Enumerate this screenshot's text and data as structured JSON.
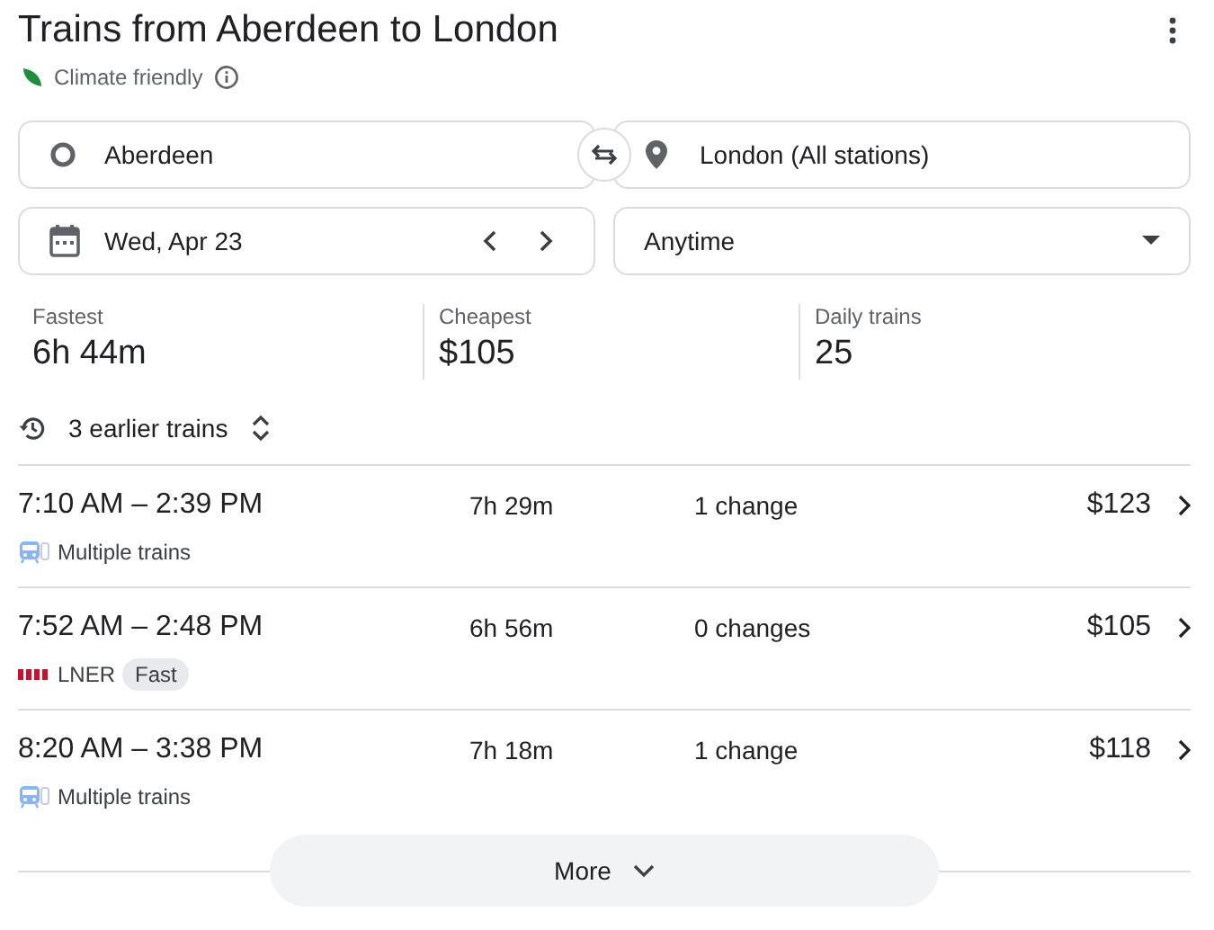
{
  "title": "Trains from Aberdeen to London",
  "climate_label": "Climate friendly",
  "origin": {
    "value": "Aberdeen"
  },
  "destination": {
    "value": "London (All stations)"
  },
  "date": {
    "value": "Wed, Apr 23"
  },
  "time": {
    "value": "Anytime"
  },
  "stats": [
    {
      "label": "Fastest",
      "value": "6h 44m"
    },
    {
      "label": "Cheapest",
      "value": "$105"
    },
    {
      "label": "Daily trains",
      "value": "25"
    }
  ],
  "earlier_trains": "3 earlier trains",
  "trips": [
    {
      "times": "7:10 AM – 2:39 PM",
      "duration": "7h 29m",
      "changes": "1 change",
      "price": "$123",
      "operator": {
        "kind": "multiple",
        "name": "Multiple trains"
      }
    },
    {
      "times": "7:52 AM – 2:48 PM",
      "duration": "6h 56m",
      "changes": "0 changes",
      "price": "$105",
      "operator": {
        "kind": "lner",
        "name": "LNER"
      },
      "tags": [
        "Fast"
      ]
    },
    {
      "times": "8:20 AM – 3:38 PM",
      "duration": "7h 18m",
      "changes": "1 change",
      "price": "$118",
      "operator": {
        "kind": "multiple",
        "name": "Multiple trains"
      }
    }
  ],
  "more_button": "More"
}
